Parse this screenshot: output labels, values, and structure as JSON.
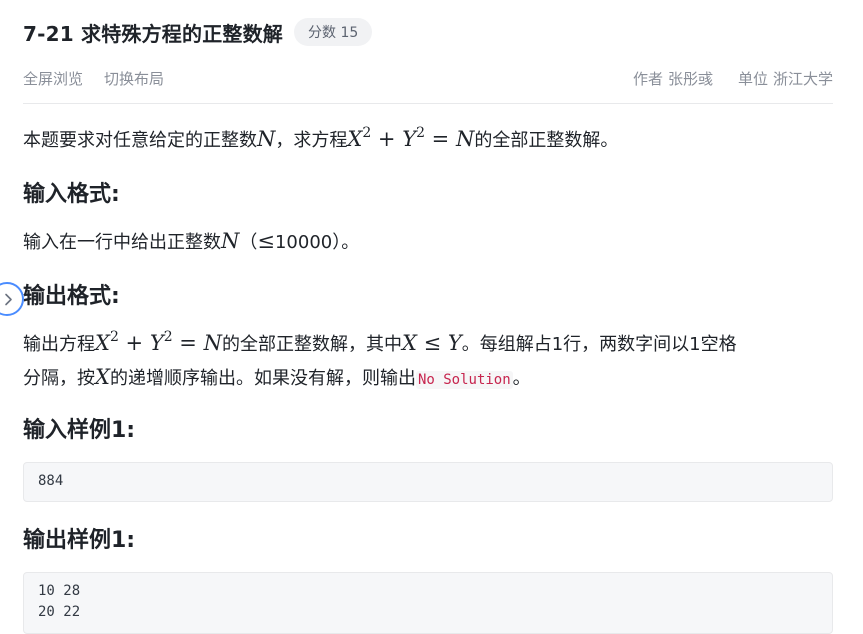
{
  "header": {
    "title": "7-21 求特殊方程的正整数解",
    "score_badge": "分数 15"
  },
  "toolbar": {
    "fullscreen_label": "全屏浏览",
    "switch_layout_label": "切换布局",
    "author_label": "作者",
    "author_value": "张彤彧",
    "unit_label": "单位",
    "unit_value": "浙江大学"
  },
  "problem": {
    "desc_pre": "本题要求对任意给定的正整数",
    "desc_N": "N",
    "desc_mid": "，求方程",
    "eq_X": "X",
    "eq_sup1": "2",
    "eq_plus": " + ",
    "eq_Y": "Y",
    "eq_sup2": "2",
    "eq_eq": " = ",
    "eq_N": "N",
    "desc_post": "的全部正整数解。",
    "input_heading": "输入格式:",
    "input_pre": "输入在一行中给出正整数",
    "input_N": "N",
    "input_paren_open": "（",
    "input_le": "≤",
    "input_num": "10000",
    "input_post": "）。",
    "output_heading": "输出格式:",
    "out_pre": "输出方程",
    "out_X": "X",
    "out_sup1": "2",
    "out_plus": " + ",
    "out_Y": "Y",
    "out_sup2": "2",
    "out_eq": " = ",
    "out_N": "N",
    "out_mid": "的全部正整数解，其中",
    "out_X2": "X",
    "out_le": " ≤ ",
    "out_Y2": "Y",
    "out_tail1": "。每组解占1行，两数字间以1空格",
    "out_line2_pre": "分隔，按",
    "out_X3": "X",
    "out_line2_mid": "的递增顺序输出。如果没有解，则输出",
    "out_code": "No Solution",
    "out_line2_post": "。",
    "sample_in_heading": "输入样例1:",
    "sample_in_lines": [
      "884"
    ],
    "sample_out_heading": "输出样例1:",
    "sample_out_lines": [
      "10 28",
      "20 22"
    ]
  },
  "icons": {
    "side_toggle": "chevron-right-icon"
  },
  "colors": {
    "accent": "#4a8cff",
    "inline_code": "#c7254e"
  }
}
